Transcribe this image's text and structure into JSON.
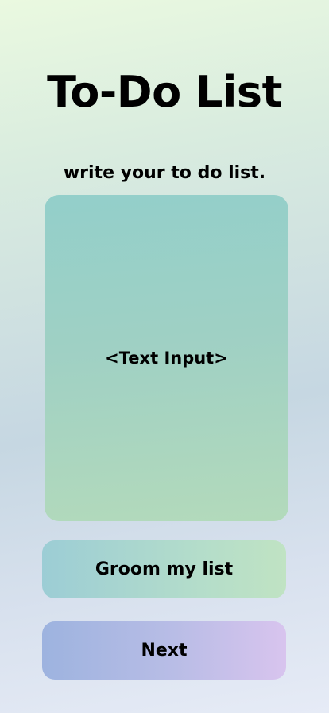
{
  "header": {
    "title": "To-Do List"
  },
  "main": {
    "instruction": "write your to do list.",
    "text_input_label": "<Text Input>"
  },
  "actions": {
    "groom_label": "Groom my list",
    "next_label": "Next"
  },
  "colors": {
    "text": "#000000",
    "input_bg": "#9fd0c4",
    "groom_bg": "#b4ddca",
    "next_bg": "#b9bde6"
  }
}
